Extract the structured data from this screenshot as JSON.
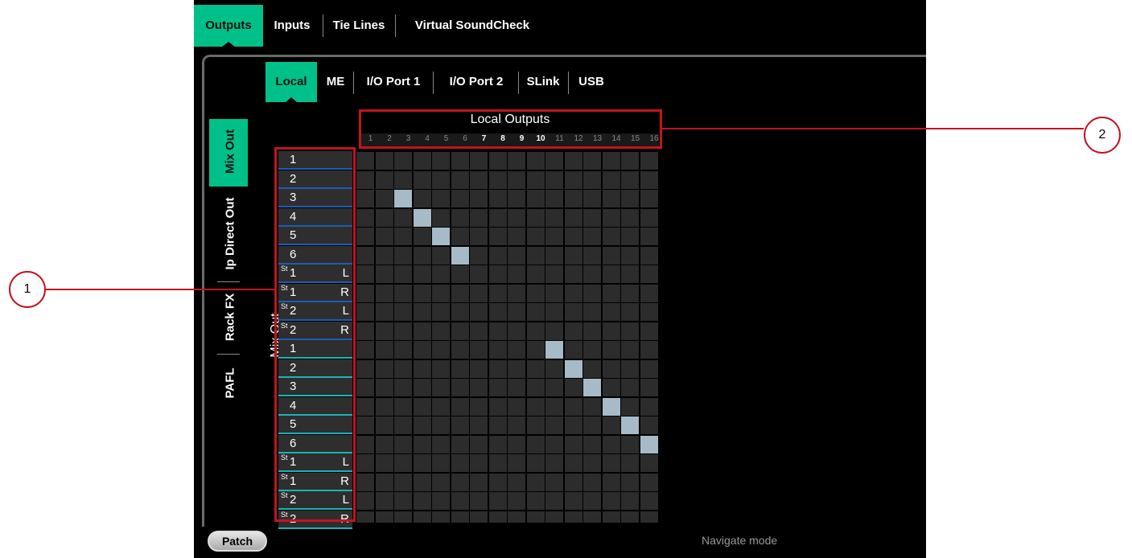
{
  "top_tabs": [
    {
      "label": "Outputs",
      "active": true
    },
    {
      "label": "Inputs",
      "active": false
    },
    {
      "label": "Tie Lines",
      "active": false
    },
    {
      "label": "Virtual SoundCheck",
      "active": false
    }
  ],
  "sub_tabs": [
    {
      "label": "Local",
      "active": true
    },
    {
      "label": "ME",
      "active": false
    },
    {
      "label": "I/O Port 1",
      "active": false
    },
    {
      "label": "I/O Port 2",
      "active": false
    },
    {
      "label": "SLink",
      "active": false
    },
    {
      "label": "USB",
      "active": false
    }
  ],
  "side_tabs": [
    {
      "label": "Mix Out",
      "active": true
    },
    {
      "label": "Ip Direct Out",
      "active": false
    },
    {
      "label": "Rack FX",
      "active": false
    },
    {
      "label": "PAFL",
      "active": false
    }
  ],
  "matrix": {
    "title": "Local Outputs",
    "row_group_label": "Mix Out",
    "columns": [
      "1",
      "2",
      "3",
      "4",
      "5",
      "6",
      "7",
      "8",
      "9",
      "10",
      "11",
      "12",
      "13",
      "14",
      "15",
      "16"
    ],
    "bright_columns": [
      "7",
      "8",
      "9",
      "10"
    ],
    "rows": [
      {
        "prefix": "",
        "num": "1",
        "side": "",
        "group": "blue"
      },
      {
        "prefix": "",
        "num": "2",
        "side": "",
        "group": "blue"
      },
      {
        "prefix": "",
        "num": "3",
        "side": "",
        "group": "blue"
      },
      {
        "prefix": "",
        "num": "4",
        "side": "",
        "group": "blue"
      },
      {
        "prefix": "",
        "num": "5",
        "side": "",
        "group": "blue"
      },
      {
        "prefix": "",
        "num": "6",
        "side": "",
        "group": "blue"
      },
      {
        "prefix": "St",
        "num": "1",
        "side": "L",
        "group": "blue"
      },
      {
        "prefix": "St",
        "num": "1",
        "side": "R",
        "group": "blue"
      },
      {
        "prefix": "St",
        "num": "2",
        "side": "L",
        "group": "blue"
      },
      {
        "prefix": "St",
        "num": "2",
        "side": "R",
        "group": "blue"
      },
      {
        "prefix": "",
        "num": "1",
        "side": "",
        "group": "teal"
      },
      {
        "prefix": "",
        "num": "2",
        "side": "",
        "group": "teal"
      },
      {
        "prefix": "",
        "num": "3",
        "side": "",
        "group": "teal"
      },
      {
        "prefix": "",
        "num": "4",
        "side": "",
        "group": "teal"
      },
      {
        "prefix": "",
        "num": "5",
        "side": "",
        "group": "teal"
      },
      {
        "prefix": "",
        "num": "6",
        "side": "",
        "group": "teal"
      },
      {
        "prefix": "St",
        "num": "1",
        "side": "L",
        "group": "teal"
      },
      {
        "prefix": "St",
        "num": "1",
        "side": "R",
        "group": "teal"
      },
      {
        "prefix": "St",
        "num": "2",
        "side": "L",
        "group": "teal"
      },
      {
        "prefix": "St",
        "num": "2",
        "side": "R",
        "group": "teal"
      }
    ],
    "patched": [
      {
        "row": 2,
        "col": 2
      },
      {
        "row": 3,
        "col": 3
      },
      {
        "row": 4,
        "col": 4
      },
      {
        "row": 5,
        "col": 5
      },
      {
        "row": 10,
        "col": 10
      },
      {
        "row": 11,
        "col": 11
      },
      {
        "row": 12,
        "col": 12
      },
      {
        "row": 13,
        "col": 13
      },
      {
        "row": 14,
        "col": 14
      },
      {
        "row": 15,
        "col": 15
      }
    ]
  },
  "buttons": {
    "patch": "Patch"
  },
  "status": {
    "mode": "Navigate mode"
  },
  "callouts": {
    "one": "1",
    "two": "2"
  },
  "colors": {
    "accent": "#00c08a",
    "blue_group": "#1f5bb5",
    "teal_group": "#19b3b3",
    "patched_cell": "#a6bac8",
    "callout_red": "#c21420"
  }
}
